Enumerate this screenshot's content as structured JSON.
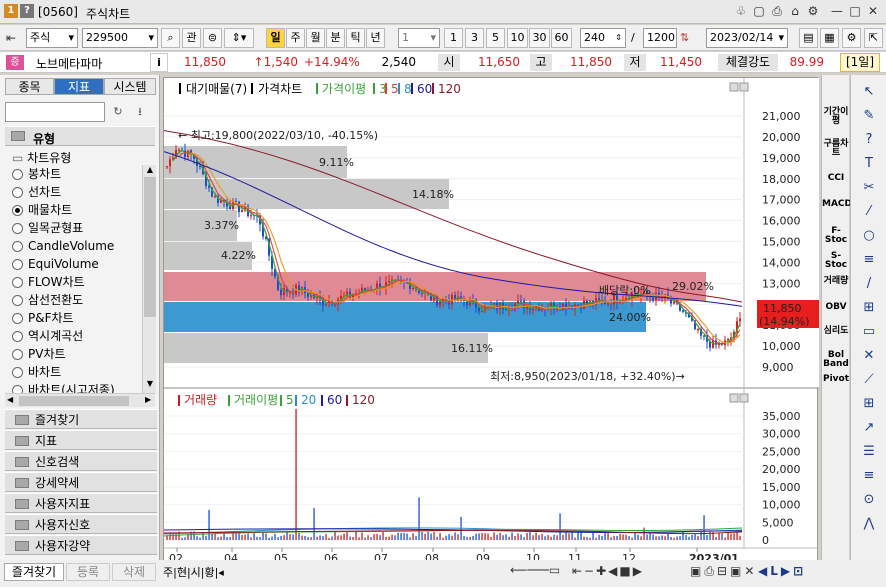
{
  "window": {
    "code": "[0560]",
    "title": "주식차트",
    "badge1": "1",
    "badge2": "?",
    "controls": [
      "♧",
      "▢",
      "⎙",
      "⌂",
      "⚙",
      "—",
      "□",
      "✕"
    ]
  },
  "toolbar": {
    "market": "주식",
    "stock_code": "229500",
    "btn_search": "관",
    "periods": [
      "일",
      "주",
      "월",
      "분",
      "틱",
      "년"
    ],
    "interval_value": "1",
    "intervals": [
      "1",
      "3",
      "5",
      "10",
      "30",
      "60"
    ],
    "count": "240",
    "total": "1200",
    "date": "2023/02/14"
  },
  "info": {
    "tag": "증",
    "stock_name": "노브메타파마",
    "info_btn": "i",
    "price": "11,850",
    "change": "↑1,540",
    "change_pct": "+14.94%",
    "volume": "2,540",
    "open_label": "시",
    "open": "11,650",
    "high_label": "고",
    "high": "11,850",
    "low_label": "저",
    "low": "11,450",
    "strength_label": "체결강도",
    "strength": "89.99",
    "period_tag": "[1일]"
  },
  "left": {
    "tabs": [
      "종목",
      "지표",
      "시스템"
    ],
    "section": "유형",
    "subsection": "차트유형",
    "types": [
      "봉차트",
      "선차트",
      "매물차트",
      "일목균형표",
      "CandleVolume",
      "EquiVolume",
      "FLOW차트",
      "삼선전환도",
      "P&F차트",
      "역시계곡선",
      "PV차트",
      "바차트",
      "바차트(시고저종)"
    ],
    "selected": "매물차트",
    "folders": [
      "즐겨찾기",
      "지표",
      "신호검색",
      "강세약세",
      "사용자지표",
      "사용자신호",
      "사용자강약"
    ],
    "bottom_tabs": [
      "즐겨찾기",
      "등록",
      "삭제"
    ]
  },
  "price_legend": {
    "items": [
      "대기매물(7)",
      "가격차트",
      "가격이평",
      "3",
      "5",
      "8",
      "60",
      "120"
    ],
    "colors": [
      "#000",
      "#000",
      "#3aa13a",
      "#3aa13a",
      "#e04040",
      "#2a8fd0",
      "#1a1aa0",
      "#8a1a2a"
    ]
  },
  "volume_legend": {
    "items": [
      "거래량",
      "거래이평",
      "5",
      "20",
      "60",
      "120"
    ],
    "colors": [
      "#c41e1e",
      "#3aa13a",
      "#3aa13a",
      "#2a8fd0",
      "#1a1aa0",
      "#8a1a2a"
    ]
  },
  "annotations": {
    "high": "← 최고:19,800(2022/03/10, -40.15%)",
    "low": "최저:8,950(2023/01/18, +32.40%)→",
    "pct_labels": [
      "9.11%",
      "14.18%",
      "3.37%",
      "4.22%",
      "29.02%",
      "24.00%",
      "16.11%"
    ],
    "baedang": "배당락:0%"
  },
  "price_axis": [
    "21,000",
    "20,000",
    "19,000",
    "18,000",
    "17,000",
    "16,000",
    "15,000",
    "14,000",
    "13,000",
    "12,000",
    "11,000",
    "10,000",
    "9,000"
  ],
  "volume_axis": [
    "35,000",
    "30,000",
    "25,000",
    "20,000",
    "15,000",
    "10,000",
    "5,000",
    "0"
  ],
  "x_axis": [
    "02",
    "04",
    "05",
    "06",
    "07",
    "08",
    "09",
    "10",
    "11",
    "12",
    "2023/01"
  ],
  "last_price": {
    "price": "11,850",
    "pct": "(14.94%)"
  },
  "right_tools": [
    "기간이평",
    "구름차트",
    "CCI",
    "MACD",
    "F-Stoc",
    "S-Stoc",
    "거래량",
    "OBV",
    "심리도",
    "Bol Band",
    "Pivot"
  ],
  "chart_data": {
    "type": "candlestick",
    "ylim": [
      8500,
      21800
    ],
    "price_levels": [
      21000,
      20000,
      19000,
      18000,
      17000,
      16000,
      15000,
      14000,
      13000,
      12000,
      11000,
      10000,
      9000
    ],
    "volume_levels": [
      35000,
      30000,
      25000,
      20000,
      15000,
      10000,
      5000,
      0
    ],
    "volume_profile": [
      9.11,
      14.18,
      3.37,
      4.22,
      29.02,
      24.0,
      16.11
    ],
    "max": {
      "price": 19800,
      "date": "2022/03/10"
    },
    "min": {
      "price": 8950,
      "date": "2023/01/18"
    },
    "last": 11850
  }
}
